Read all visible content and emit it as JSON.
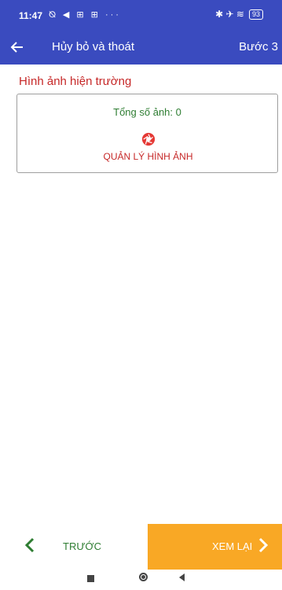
{
  "status_bar": {
    "time": "11:47",
    "left_icons": "⦰ ◀ ⊞ ⊞ ···",
    "right_icons": "✱ ✈ ≋",
    "battery": "93"
  },
  "app_bar": {
    "back_icon": "arrow-left-icon",
    "title": "Hủy bỏ và thoát",
    "step": "Bước 3"
  },
  "section": {
    "title": "Hình ảnh hiện trường"
  },
  "photo_card": {
    "count_text": "Tổng số ảnh: 0",
    "manage_label": "QUẢN LÝ HÌNH ẢNH",
    "manage_icon": "camera-shutter-icon"
  },
  "footer": {
    "prev_label": "TRƯỚC",
    "next_label": "XEM LẠI"
  },
  "colors": {
    "primary": "#3a4bbf",
    "accent_red": "#c62828",
    "accent_green": "#2e7d32",
    "accent_orange": "#f9a825"
  }
}
